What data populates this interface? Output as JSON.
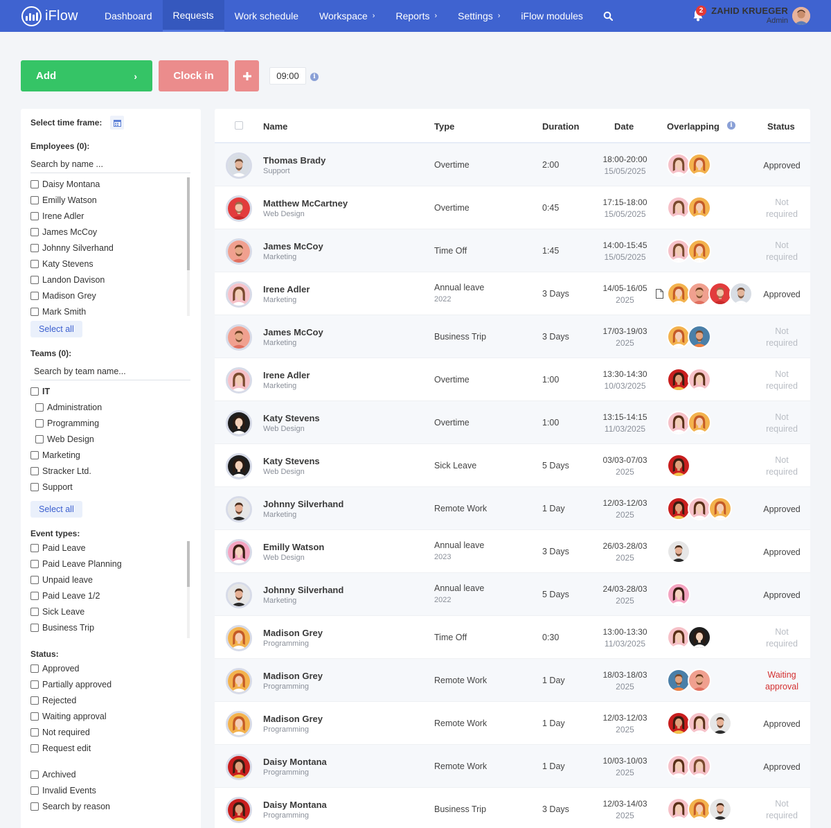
{
  "app": {
    "name": "iFlow"
  },
  "nav": {
    "items": [
      {
        "label": "Dashboard",
        "chevron": false
      },
      {
        "label": "Requests",
        "chevron": false,
        "active": true
      },
      {
        "label": "Work schedule",
        "chevron": false
      },
      {
        "label": "Workspace",
        "chevron": true
      },
      {
        "label": "Reports",
        "chevron": true
      },
      {
        "label": "Settings",
        "chevron": true
      },
      {
        "label": "iFlow modules",
        "chevron": false
      }
    ],
    "search_icon": "search-icon",
    "notifications": {
      "icon": "bell-icon",
      "count": "2"
    },
    "user": {
      "name": "ZAHID KRUEGER",
      "role": "Admin"
    }
  },
  "toolbar": {
    "add_label": "Add",
    "add_icon": "chevron-right-icon",
    "clock_in_label": "Clock in",
    "plus_icon": "plus-icon",
    "time_value": "09:00",
    "info_icon": "info-icon"
  },
  "colors": {
    "nav_bg": "#3f63d0",
    "add_green": "#35c466",
    "clock_pink": "#eb8c8c",
    "waiting_red": "#d32f2f",
    "not_required_gray": "#b9bdc4"
  },
  "filters": {
    "time_frame_label": "Select time frame:",
    "calendar_icon": "calendar-icon",
    "employees_label": "Employees (0):",
    "employee_search_placeholder": "Search by name ...",
    "employees": [
      "Daisy Montana",
      "Emilly Watson",
      "Irene Adler",
      "James McCoy",
      "Johnny Silverhand",
      "Katy Stevens",
      "Landon Davison",
      "Madison Grey",
      "Mark Smith"
    ],
    "select_all": "Select all",
    "teams_label": "Teams (0):",
    "team_search_placeholder": "Search by team name...",
    "teams": [
      {
        "label": "IT",
        "level": 0,
        "bold": true
      },
      {
        "label": "Administration",
        "level": 1
      },
      {
        "label": "Programming",
        "level": 1
      },
      {
        "label": "Web Design",
        "level": 1
      },
      {
        "label": "Marketing",
        "level": 0
      },
      {
        "label": "Stracker Ltd.",
        "level": 0
      },
      {
        "label": "Support",
        "level": 0
      }
    ],
    "event_types_label": "Event types:",
    "event_types": [
      "Paid Leave",
      "Paid Leave Planning",
      "Unpaid leave",
      "Paid Leave 1/2",
      "Sick Leave",
      "Business Trip"
    ],
    "status_label": "Status:",
    "statuses": [
      "Approved",
      "Partially approved",
      "Rejected",
      "Waiting approval",
      "Not required",
      "Request edit"
    ],
    "extras": [
      "Archived",
      "Invalid Events",
      "Search by reason"
    ]
  },
  "table": {
    "columns": {
      "name": "Name",
      "type": "Type",
      "duration": "Duration",
      "date": "Date",
      "overlapping": "Overlapping",
      "status": "Status"
    },
    "rows": [
      {
        "name": "Thomas Brady",
        "dept": "Support",
        "type": "Overtime",
        "year": "",
        "duration": "2:00",
        "date1": "18:00-20:00",
        "date2": "15/05/2025",
        "overlap": [
          "irene",
          "madison"
        ],
        "doc": false,
        "status1": "Approved",
        "status2": "",
        "status_kind": "approved",
        "avatar": "thomas"
      },
      {
        "name": "Matthew McCartney",
        "dept": "Web Design",
        "type": "Overtime",
        "year": "",
        "duration": "0:45",
        "date1": "17:15-18:00",
        "date2": "15/05/2025",
        "overlap": [
          "irene",
          "madison"
        ],
        "doc": false,
        "status1": "Not",
        "status2": "required",
        "status_kind": "notreq",
        "avatar": "matthew"
      },
      {
        "name": "James McCoy",
        "dept": "Marketing",
        "type": "Time Off",
        "year": "",
        "duration": "1:45",
        "date1": "14:00-15:45",
        "date2": "15/05/2025",
        "overlap": [
          "irene",
          "madison"
        ],
        "doc": false,
        "status1": "Not",
        "status2": "required",
        "status_kind": "notreq",
        "avatar": "james"
      },
      {
        "name": "Irene Adler",
        "dept": "Marketing",
        "type": "Annual leave",
        "year": "2022",
        "duration": "3 Days",
        "date1": "14/05-16/05",
        "date2": "2025",
        "overlap": [
          "madison",
          "james",
          "matthew",
          "thomas"
        ],
        "doc": true,
        "status1": "Approved",
        "status2": "",
        "status_kind": "approved",
        "avatar": "irene"
      },
      {
        "name": "James McCoy",
        "dept": "Marketing",
        "type": "Business Trip",
        "year": "",
        "duration": "3 Days",
        "date1": "17/03-19/03",
        "date2": "2025",
        "overlap": [
          "madison",
          "landon"
        ],
        "doc": false,
        "status1": "Not",
        "status2": "required",
        "status_kind": "notreq",
        "avatar": "james"
      },
      {
        "name": "Irene Adler",
        "dept": "Marketing",
        "type": "Overtime",
        "year": "",
        "duration": "1:00",
        "date1": "13:30-14:30",
        "date2": "10/03/2025",
        "overlap": [
          "daisy",
          "irene2"
        ],
        "doc": false,
        "status1": "Not",
        "status2": "required",
        "status_kind": "notreq",
        "avatar": "irene"
      },
      {
        "name": "Katy Stevens",
        "dept": "Web Design",
        "type": "Overtime",
        "year": "",
        "duration": "1:00",
        "date1": "13:15-14:15",
        "date2": "11/03/2025",
        "overlap": [
          "irene2",
          "madison"
        ],
        "doc": false,
        "status1": "Not",
        "status2": "required",
        "status_kind": "notreq",
        "avatar": "katy"
      },
      {
        "name": "Katy Stevens",
        "dept": "Web Design",
        "type": "Sick Leave",
        "year": "",
        "duration": "5 Days",
        "date1": "03/03-07/03",
        "date2": "2025",
        "overlap": [
          "daisy"
        ],
        "doc": false,
        "status1": "Not",
        "status2": "required",
        "status_kind": "notreq",
        "avatar": "katy"
      },
      {
        "name": "Johnny Silverhand",
        "dept": "Marketing",
        "type": "Remote Work",
        "year": "",
        "duration": "1 Day",
        "date1": "12/03-12/03",
        "date2": "2025",
        "overlap": [
          "daisy",
          "irene2",
          "madison"
        ],
        "doc": false,
        "status1": "Approved",
        "status2": "",
        "status_kind": "approved",
        "avatar": "johnny"
      },
      {
        "name": "Emilly Watson",
        "dept": "Web Design",
        "type": "Annual leave",
        "year": "2023",
        "duration": "3 Days",
        "date1": "26/03-28/03",
        "date2": "2025",
        "overlap": [
          "johnny"
        ],
        "doc": false,
        "status1": "Approved",
        "status2": "",
        "status_kind": "approved",
        "avatar": "emilly"
      },
      {
        "name": "Johnny Silverhand",
        "dept": "Marketing",
        "type": "Annual leave",
        "year": "2022",
        "duration": "5 Days",
        "date1": "24/03-28/03",
        "date2": "2025",
        "overlap": [
          "emilly"
        ],
        "doc": false,
        "status1": "Approved",
        "status2": "",
        "status_kind": "approved",
        "avatar": "johnny"
      },
      {
        "name": "Madison Grey",
        "dept": "Programming",
        "type": "Time Off",
        "year": "",
        "duration": "0:30",
        "date1": "13:00-13:30",
        "date2": "11/03/2025",
        "overlap": [
          "irene2",
          "katy"
        ],
        "doc": false,
        "status1": "Not",
        "status2": "required",
        "status_kind": "notreq",
        "avatar": "madison"
      },
      {
        "name": "Madison Grey",
        "dept": "Programming",
        "type": "Remote Work",
        "year": "",
        "duration": "1 Day",
        "date1": "18/03-18/03",
        "date2": "2025",
        "overlap": [
          "landon",
          "james"
        ],
        "doc": false,
        "status1": "Waiting",
        "status2": "approval",
        "status_kind": "waiting",
        "avatar": "madison"
      },
      {
        "name": "Madison Grey",
        "dept": "Programming",
        "type": "Remote Work",
        "year": "",
        "duration": "1 Day",
        "date1": "12/03-12/03",
        "date2": "2025",
        "overlap": [
          "daisy",
          "irene2",
          "johnny"
        ],
        "doc": false,
        "status1": "Approved",
        "status2": "",
        "status_kind": "approved",
        "avatar": "madison"
      },
      {
        "name": "Daisy Montana",
        "dept": "Programming",
        "type": "Remote Work",
        "year": "",
        "duration": "1 Day",
        "date1": "10/03-10/03",
        "date2": "2025",
        "overlap": [
          "irene2",
          "irene"
        ],
        "doc": false,
        "status1": "Approved",
        "status2": "",
        "status_kind": "approved",
        "avatar": "daisy"
      },
      {
        "name": "Daisy Montana",
        "dept": "Programming",
        "type": "Business Trip",
        "year": "",
        "duration": "3 Days",
        "date1": "12/03-14/03",
        "date2": "2025",
        "overlap": [
          "irene2",
          "madison",
          "johnny"
        ],
        "doc": false,
        "status1": "Not",
        "status2": "required",
        "status_kind": "notreq",
        "avatar": "daisy"
      }
    ]
  }
}
